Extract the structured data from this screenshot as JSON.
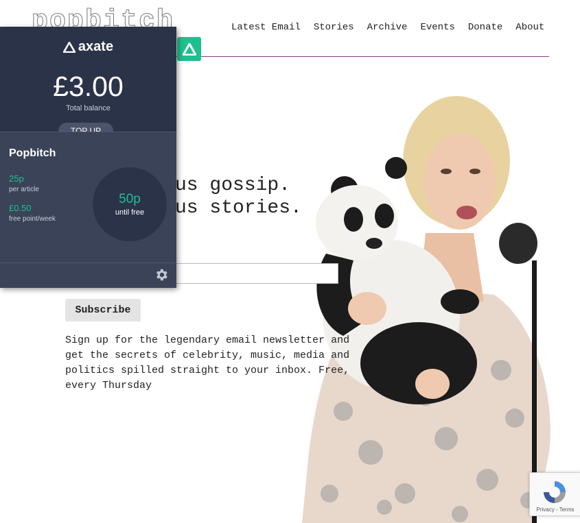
{
  "site": {
    "logo_text": "popbitch",
    "nav": [
      "Latest Email",
      "Stories",
      "Archive",
      "Events",
      "Donate",
      "About"
    ]
  },
  "hero": {
    "headline_line1": "us gossip.",
    "headline_line2": "us stories.",
    "email_placeholder": "",
    "subscribe_label": "Subscribe",
    "blurb": "Sign up for the legendary email newsletter and get the secrets of celebrity, music, media and politics spilled straight to your inbox. Free, every Thursday"
  },
  "axate": {
    "brand": "axate",
    "balance": "£3.00",
    "balance_label": "Total balance",
    "topup_label": "TOP UP",
    "publication": "Popbitch",
    "price_value": "25p",
    "price_label": "per article",
    "free_point_value": "£0.50",
    "free_point_label": "free point/week",
    "until_free_value": "50p",
    "until_free_label": "until free",
    "settings_icon": "gear-icon"
  },
  "recaptcha": {
    "terms": "Privacy - Terms"
  },
  "colors": {
    "axate_dark": "#2b3349",
    "axate_mid": "#3a4358",
    "axate_green": "#1fbf8f",
    "nav_rule": "#8a3a8f"
  }
}
